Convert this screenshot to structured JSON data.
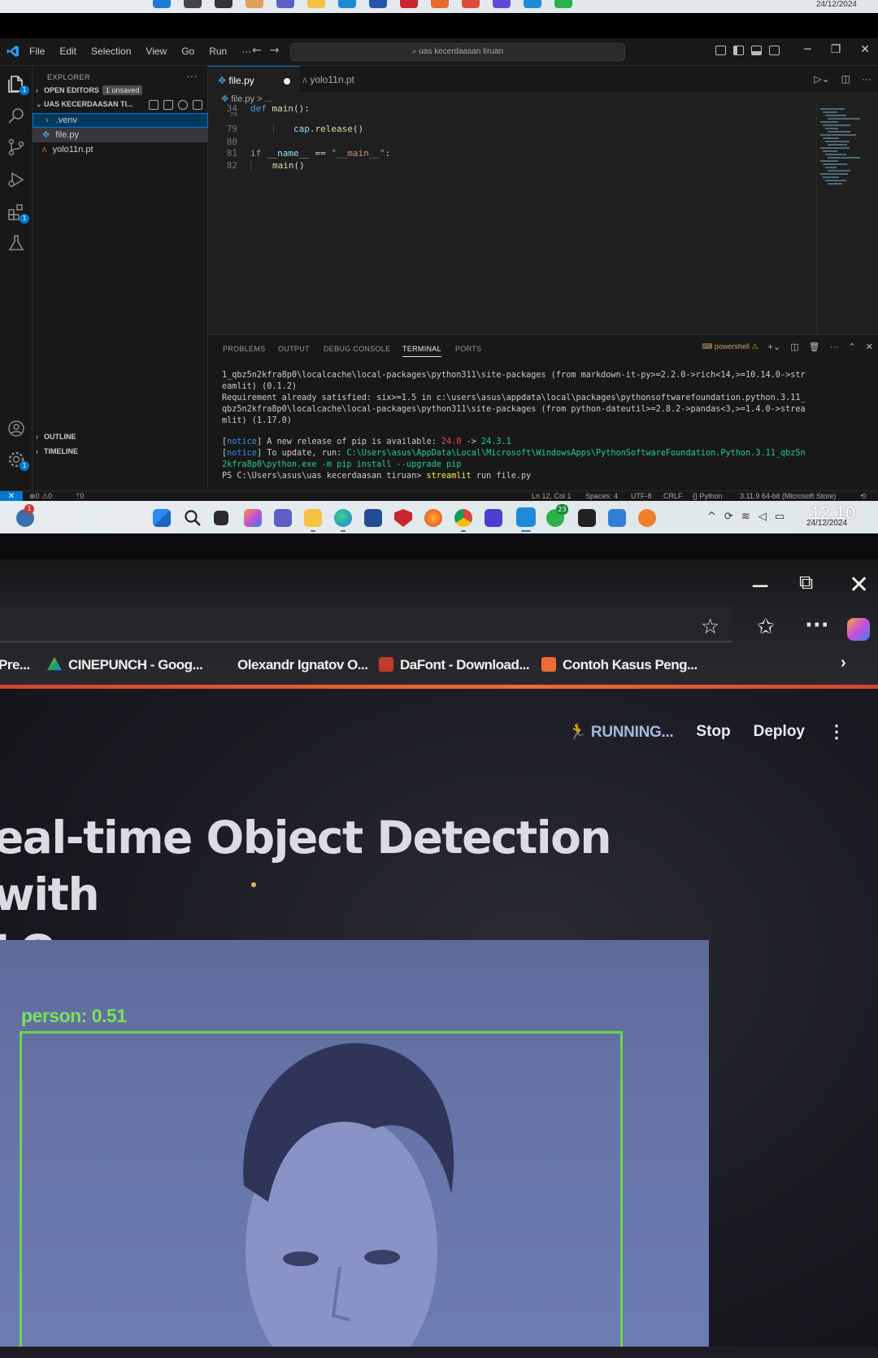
{
  "top_strip": {
    "date": "24/12/2024"
  },
  "vscode": {
    "menu": [
      "File",
      "Edit",
      "Selection",
      "View",
      "Go",
      "Run",
      "···"
    ],
    "search_text": "uas kecerdaasan tiruan",
    "activity_badges": {
      "explorer": "1",
      "extensions": "1",
      "settings": "1"
    },
    "sidebar": {
      "header": "EXPLORER",
      "more": "···",
      "open_editors": "OPEN EDITORS",
      "unsaved_badge": "1 unsaved",
      "folder": "UAS KECERDAASAN TI...",
      "tree": [
        {
          "name": ".venv",
          "kind": "folder"
        },
        {
          "name": "file.py",
          "kind": "python"
        },
        {
          "name": "yolo11n.pt",
          "kind": "pt"
        }
      ],
      "outline": "OUTLINE",
      "timeline": "TIMELINE"
    },
    "tabs": [
      {
        "label": "file.py",
        "modified": true
      },
      {
        "label": "yolo11n.pt",
        "modified": false
      }
    ],
    "breadcrumb": "file.py > ...",
    "code": [
      {
        "ln": "34",
        "text": "def main():"
      },
      {
        "ln": "78",
        "text": ""
      },
      {
        "ln": "79",
        "text": "        cap.release()"
      },
      {
        "ln": "80",
        "text": ""
      },
      {
        "ln": "81",
        "text": "if __name__ == \"__main__\":"
      },
      {
        "ln": "82",
        "text": "    main()"
      }
    ],
    "panel_tabs": [
      "PROBLEMS",
      "OUTPUT",
      "DEBUG CONSOLE",
      "TERMINAL",
      "PORTS"
    ],
    "active_panel_tab": "TERMINAL",
    "shell": "powershell",
    "terminal": {
      "l1": "1_qbz5n2kfra8p0\\localcache\\local-packages\\python311\\site-packages (from markdown-it-py>=2.2.0->rich<14,>=10.14.0->str",
      "l2": "eamlit) (0.1.2)",
      "l3": "Requirement already satisfied: six>=1.5 in c:\\users\\asus\\appdata\\local\\packages\\pythonsoftwarefoundation.python.3.11_",
      "l4": "qbz5n2kfra8p0\\localcache\\local-packages\\python311\\site-packages (from python-dateutil>=2.8.2->pandas<3,>=1.4.0->strea",
      "l5": "mlit) (1.17.0)",
      "notice": "notice",
      "n1_text": " A new release of pip is available: ",
      "n1_old": "24.0",
      "n1_arrow": " -> ",
      "n1_new": "24.3.1",
      "n2_text": " To update, run: ",
      "n2_cmd": "C:\\Users\\asus\\AppData\\Local\\Microsoft\\WindowsApps\\PythonSoftwareFoundation.Python.3.11_qbz5n",
      "n2_cmd2": "2kfra8p0\\python.exe -m pip install --upgrade pip",
      "prompt": "PS C:\\Users\\asus\\uas kecerdaasan tiruan> ",
      "prompt_cmd": "streamlit",
      "prompt_args": " run file.py"
    },
    "status": {
      "errors": "0",
      "warnings": "0",
      "ports": "0",
      "position": "Ln 12, Col 1",
      "spaces": "Spaces: 4",
      "encoding": "UTF-8",
      "eol": "CRLF",
      "language": "Python",
      "interpreter": "3.11.9 64-bit (Microsoft Store)"
    }
  },
  "taskbar": {
    "time": "12.10",
    "date": "24/12/2024",
    "whatsapp_badge": "23",
    "notif_badge": "1"
  },
  "browser": {
    "bookmarks": [
      {
        "label": "Pre...",
        "color": ""
      },
      {
        "label": "CINEPUNCH - Goog...",
        "color": "#1aa260"
      },
      {
        "label": "Olexandr Ignatov O...",
        "color": ""
      },
      {
        "label": "DaFont - Download...",
        "color": "#c23a2c"
      },
      {
        "label": "Contoh Kasus Peng...",
        "color": "#f06a35"
      }
    ],
    "streamlit": {
      "status": "RUNNING...",
      "stop": "Stop",
      "deploy": "Deploy",
      "menu": "⋮",
      "title_line1": "eal-time Object Detection with",
      "title_line2": "LO"
    },
    "detection": {
      "label": "person: 0.51",
      "box_color": "#69d84b"
    }
  }
}
